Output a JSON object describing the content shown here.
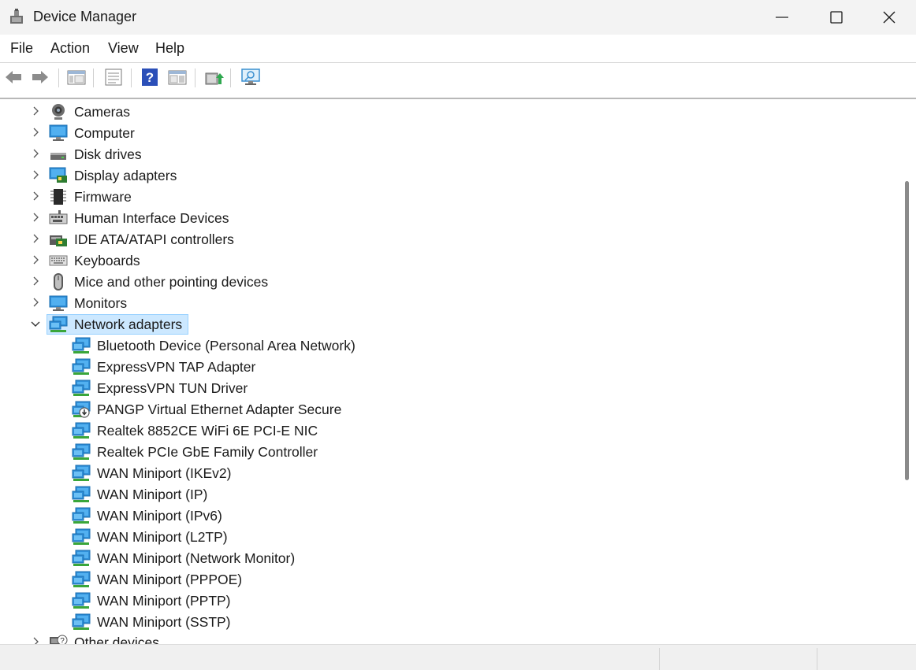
{
  "window": {
    "title": "Device Manager",
    "app_icon": "device-manager-icon",
    "controls": [
      "minimize-icon",
      "maximize-icon",
      "close-icon"
    ]
  },
  "menu": {
    "items": [
      {
        "label": "File"
      },
      {
        "label": "Action"
      },
      {
        "label": "View"
      },
      {
        "label": "Help"
      }
    ]
  },
  "toolbar": {
    "buttons": [
      "back-arrow-icon",
      "forward-arrow-icon",
      "show-hide-console-tree-icon",
      "properties-icon",
      "help-icon",
      "action-pane-icon",
      "update-driver-icon",
      "scan-hardware-icon"
    ]
  },
  "tree": {
    "categories": [
      {
        "label": "Cameras",
        "icon": "camera-icon",
        "expanded": false
      },
      {
        "label": "Computer",
        "icon": "computer-icon",
        "expanded": false
      },
      {
        "label": "Disk drives",
        "icon": "disk-drive-icon",
        "expanded": false
      },
      {
        "label": "Display adapters",
        "icon": "display-adapter-icon",
        "expanded": false
      },
      {
        "label": "Firmware",
        "icon": "firmware-chip-icon",
        "expanded": false
      },
      {
        "label": "Human Interface Devices",
        "icon": "hid-icon",
        "expanded": false
      },
      {
        "label": "IDE ATA/ATAPI controllers",
        "icon": "ide-controller-icon",
        "expanded": false
      },
      {
        "label": "Keyboards",
        "icon": "keyboard-icon",
        "expanded": false
      },
      {
        "label": "Mice and other pointing devices",
        "icon": "mouse-icon",
        "expanded": false
      },
      {
        "label": "Monitors",
        "icon": "monitor-icon",
        "expanded": false
      },
      {
        "label": "Network adapters",
        "icon": "network-adapter-icon",
        "expanded": true,
        "selected": true
      }
    ],
    "network_children": [
      {
        "label": "Bluetooth Device (Personal Area Network)",
        "icon": "network-adapter-icon"
      },
      {
        "label": "ExpressVPN TAP Adapter",
        "icon": "network-adapter-icon"
      },
      {
        "label": "ExpressVPN TUN Driver",
        "icon": "network-adapter-icon"
      },
      {
        "label": "PANGP Virtual Ethernet Adapter Secure",
        "icon": "network-adapter-disabled-icon"
      },
      {
        "label": "Realtek 8852CE WiFi 6E PCI-E NIC",
        "icon": "network-adapter-icon"
      },
      {
        "label": "Realtek PCIe GbE Family Controller",
        "icon": "network-adapter-icon"
      },
      {
        "label": "WAN Miniport (IKEv2)",
        "icon": "network-adapter-icon"
      },
      {
        "label": "WAN Miniport (IP)",
        "icon": "network-adapter-icon"
      },
      {
        "label": "WAN Miniport (IPv6)",
        "icon": "network-adapter-icon"
      },
      {
        "label": "WAN Miniport (L2TP)",
        "icon": "network-adapter-icon"
      },
      {
        "label": "WAN Miniport (Network Monitor)",
        "icon": "network-adapter-icon"
      },
      {
        "label": "WAN Miniport (PPPOE)",
        "icon": "network-adapter-icon"
      },
      {
        "label": "WAN Miniport (PPTP)",
        "icon": "network-adapter-icon"
      },
      {
        "label": "WAN Miniport (SSTP)",
        "icon": "network-adapter-icon"
      }
    ],
    "after": [
      {
        "label": "Other devices",
        "icon": "other-devices-icon",
        "expanded": false
      }
    ]
  },
  "colors": {
    "selection_bg": "#cce8ff",
    "selection_border": "#99d1ff",
    "monitor_blue": "#2f8fd8",
    "network_green": "#3aa63a"
  }
}
